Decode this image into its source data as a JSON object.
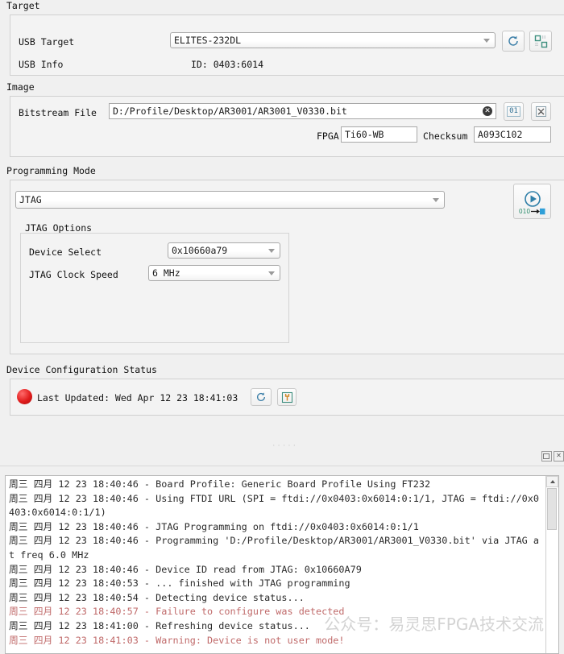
{
  "sections": {
    "target": {
      "title": "Target",
      "usb_target_label": "USB Target",
      "usb_target_value": "ELITES-232DL",
      "usb_info_label": "USB Info",
      "usb_info_value": "ID: 0403:6014",
      "refresh_icon": "refresh-icon",
      "scan_icon": "scan-chain-icon"
    },
    "image": {
      "title": "Image",
      "bitstream_label": "Bitstream File",
      "bitstream_value": "D:/Profile/Desktop/AR3001/AR3001_V0330.bit",
      "clear_icon": "clear-icon",
      "binary_icon": "binary-01-icon",
      "hex_icon": "hex-compress-icon",
      "fpga_label": "FPGA",
      "fpga_value": "Ti60-WB",
      "checksum_label": "Checksum",
      "checksum_value": "A093C102"
    },
    "programming_mode": {
      "title": "Programming Mode",
      "mode_value": "JTAG",
      "program_icon": "program-play-icon",
      "program_icon_text": "010",
      "jtag_options_title": "JTAG Options",
      "device_select_label": "Device Select",
      "device_select_value": "0x10660a79",
      "clock_speed_label": "JTAG Clock Speed",
      "clock_speed_value": "6 MHz"
    },
    "device_status": {
      "title": "Device Configuration Status",
      "led_color": "#e01b1b",
      "last_updated": "Last Updated: Wed Apr 12 23 18:41:03",
      "refresh_icon": "refresh-icon",
      "tools_icon": "wrench-chip-icon"
    }
  },
  "dock": {
    "float_icon": "float-window-icon",
    "close_icon": "close-icon",
    "grip": "·····"
  },
  "log": {
    "watermark": "公众号：易灵思FPGA技术交流",
    "lines": [
      {
        "text": "周三 四月 12 23 18:40:46 - Board Profile: Generic Board Profile Using FT232",
        "error": false
      },
      {
        "text": "周三 四月 12 23 18:40:46 - Using FTDI URL (SPI = ftdi://0x0403:0x6014:0:1/1, JTAG = ftdi://0x0403:0x6014:0:1/1)",
        "error": false
      },
      {
        "text": "周三 四月 12 23 18:40:46 - JTAG Programming on ftdi://0x0403:0x6014:0:1/1",
        "error": false
      },
      {
        "text": "周三 四月 12 23 18:40:46 - Programming 'D:/Profile/Desktop/AR3001/AR3001_V0330.bit' via JTAG at freq 6.0 MHz",
        "error": false
      },
      {
        "text": "周三 四月 12 23 18:40:46 - Device ID read from JTAG: 0x10660A79",
        "error": false
      },
      {
        "text": "周三 四月 12 23 18:40:53 - ... finished with JTAG programming",
        "error": false
      },
      {
        "text": "周三 四月 12 23 18:40:54 - Detecting device status...",
        "error": false
      },
      {
        "text": "周三 四月 12 23 18:40:57 - Failure to configure was detected",
        "error": true
      },
      {
        "text": "周三 四月 12 23 18:41:00 - Refreshing device status...",
        "error": false
      },
      {
        "text": "周三 四月 12 23 18:41:03 - Warning: Device is not user mode!",
        "error": true
      }
    ]
  }
}
